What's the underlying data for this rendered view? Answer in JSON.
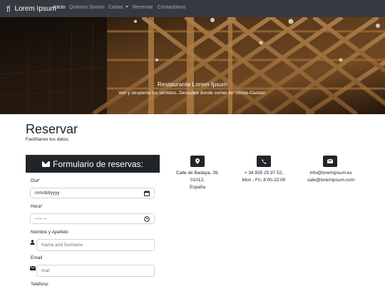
{
  "navbar": {
    "brand": "Lorem Ipsum",
    "items": [
      {
        "label": "Inicio",
        "active": true
      },
      {
        "label": "Quiénes Somos"
      },
      {
        "label": "Cartas"
      },
      {
        "label": "Reservar"
      },
      {
        "label": "Contactanos"
      }
    ]
  },
  "hero": {
    "title": "Restaurante Lorem Ipsum",
    "subtitle": "Ven y despierta tus sentidos. Descubre donde comer en Vitoria-Gasteiz."
  },
  "page": {
    "title": "Reservar",
    "subtitle": "Facilítanos tus datos."
  },
  "form": {
    "header": "Formulario de reservas:",
    "fields": {
      "date": {
        "label": "Día*",
        "value": "mm/dd/yyyy"
      },
      "time": {
        "label": "Hora*",
        "value": "--:-- --"
      },
      "name": {
        "label": "Nombre y Apellido",
        "placeholder": "Name and Surname"
      },
      "email": {
        "label": "Email",
        "placeholder": "mail"
      },
      "phone": {
        "label": "Teléfono"
      }
    }
  },
  "contact": {
    "address": [
      "Calle de Badaya, 26,",
      "01012,",
      "España"
    ],
    "phone": [
      "+ 34 935 25 97 52,",
      "Mon - Fri, 8:00-22:00"
    ],
    "email": [
      "info@loremipsum.es",
      "sale@loremipsum.com"
    ]
  },
  "icons": {
    "brand": "cutlery-icon",
    "form_header": "envelope-icon",
    "date": "calendar-icon",
    "time": "clock-icon",
    "name": "user-icon",
    "email": "envelope-icon",
    "address": "map-marker-icon",
    "phone": "phone-icon",
    "mail": "envelope-icon"
  },
  "colors": {
    "navbar": "#343a40",
    "dark": "#212529",
    "nav_active": "#ffffff",
    "nav_muted": "rgba(255,255,255,0.55)",
    "input_border": "#ced4da",
    "placeholder": "#6c757d"
  }
}
